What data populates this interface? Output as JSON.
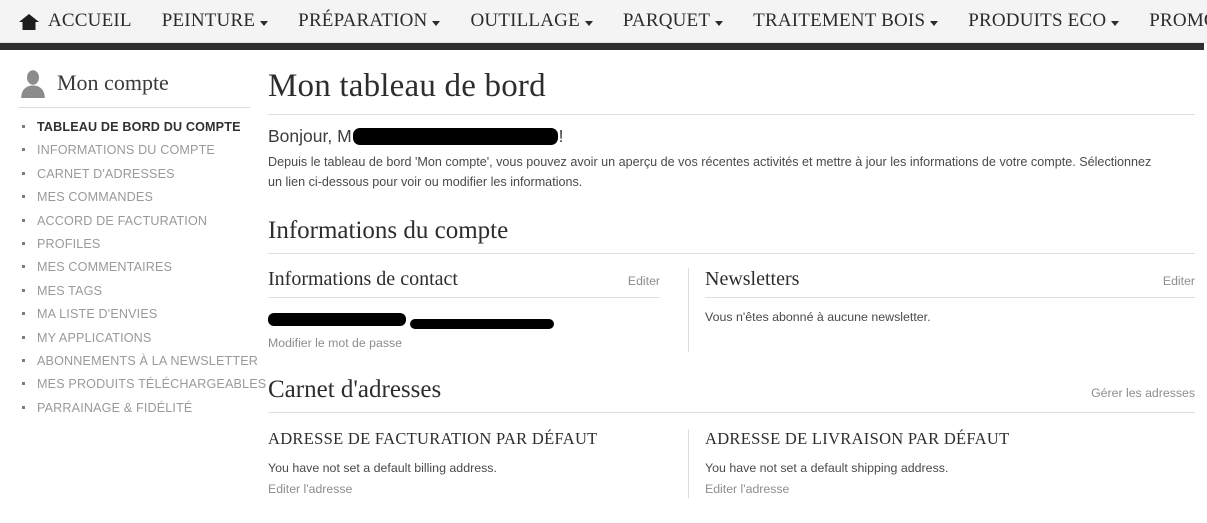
{
  "topnav": {
    "home_icon": "home-icon",
    "items": [
      {
        "label": "ACCUEIL",
        "has_caret": false,
        "has_home_icon": true
      },
      {
        "label": "PEINTURE",
        "has_caret": true
      },
      {
        "label": "PRÉPARATION",
        "has_caret": true
      },
      {
        "label": "OUTILLAGE",
        "has_caret": true
      },
      {
        "label": "PARQUET",
        "has_caret": true
      },
      {
        "label": "TRAITEMENT BOIS",
        "has_caret": true
      },
      {
        "label": "PRODUITS ECO",
        "has_caret": true
      },
      {
        "label": "PROMOTIONS",
        "has_caret": false
      }
    ]
  },
  "sidebar": {
    "icon": "user-avatar-icon",
    "title": "Mon compte",
    "items": [
      {
        "label": "TABLEAU DE BORD DU COMPTE",
        "current": true
      },
      {
        "label": "INFORMATIONS DU COMPTE",
        "current": false
      },
      {
        "label": "CARNET D'ADRESSES",
        "current": false
      },
      {
        "label": "MES COMMANDES",
        "current": false
      },
      {
        "label": "ACCORD DE FACTURATION",
        "current": false
      },
      {
        "label": "PROFILES",
        "current": false
      },
      {
        "label": "MES COMMENTAIRES",
        "current": false
      },
      {
        "label": "MES TAGS",
        "current": false
      },
      {
        "label": "MA LISTE D'ENVIES",
        "current": false
      },
      {
        "label": "MY APPLICATIONS",
        "current": false
      },
      {
        "label": "ABONNEMENTS À LA NEWSLETTER",
        "current": false
      },
      {
        "label": "MES PRODUITS TÉLÉCHARGEABLES",
        "current": false
      },
      {
        "label": "PARRAINAGE & FIDÉLITÉ",
        "current": false
      }
    ]
  },
  "main": {
    "page_title": "Mon tableau de bord",
    "greeting_prefix": "Bonjour, M",
    "greeting_redacted": true,
    "greeting_suffix": "!",
    "intro": "Depuis le tableau de bord 'Mon compte', vous pouvez avoir un aperçu de vos récentes activités et mettre à jour les informations de votre compte. Sélectionnez un lien ci-dessous pour voir ou modifier les informations.",
    "account_info": {
      "title": "Informations du compte",
      "contact": {
        "title": "Informations de contact",
        "edit_label": "Editer",
        "name_redacted": true,
        "email_redacted": true,
        "change_password_label": "Modifier le mot de passe"
      },
      "newsletters": {
        "title": "Newsletters",
        "edit_label": "Editer",
        "status_text": "Vous n'êtes abonné à aucune newsletter."
      }
    },
    "address_book": {
      "title": "Carnet d'adresses",
      "manage_label": "Gérer les adresses",
      "billing": {
        "title": "ADRESSE DE FACTURATION PAR DÉFAUT",
        "text": "You have not set a default billing address.",
        "edit_label": "Editer l'adresse"
      },
      "shipping": {
        "title": "ADRESSE DE LIVRAISON PAR DÉFAUT",
        "text": "You have not set a default shipping address.",
        "edit_label": "Editer l'adresse"
      }
    }
  },
  "colors": {
    "nav_bg": "#f4f4f4",
    "nav_underline": "#2f2f2f",
    "text": "#333333",
    "muted": "#9a9a9a",
    "rule": "#dedede",
    "redaction": "#000000"
  }
}
